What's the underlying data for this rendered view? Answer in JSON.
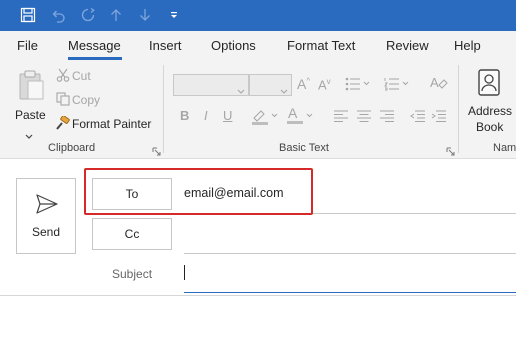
{
  "quick_access": {
    "icons": [
      "save-icon",
      "undo-icon",
      "redo-icon",
      "arrow-up-icon",
      "arrow-down-icon",
      "customize-icon"
    ]
  },
  "tabs": [
    {
      "label": "File",
      "active": false
    },
    {
      "label": "Message",
      "active": true
    },
    {
      "label": "Insert",
      "active": false
    },
    {
      "label": "Options",
      "active": false
    },
    {
      "label": "Format Text",
      "active": false
    },
    {
      "label": "Review",
      "active": false
    },
    {
      "label": "Help",
      "active": false
    }
  ],
  "ribbon": {
    "clipboard": {
      "paste_label": "Paste",
      "cut_label": "Cut",
      "copy_label": "Copy",
      "format_painter_label": "Format Painter",
      "group_label": "Clipboard"
    },
    "basic_text": {
      "group_label": "Basic Text",
      "bold": "B",
      "italic": "I",
      "underline": "U"
    },
    "names": {
      "address_book_line1": "Address",
      "address_book_line2": "Book",
      "group_label": "Nam"
    }
  },
  "compose": {
    "send_label": "Send",
    "to_label": "To",
    "to_value": "email@email.com",
    "cc_label": "Cc",
    "subject_label": "Subject"
  },
  "colors": {
    "accent": "#2b6bbf",
    "ribbon_bg": "#f3f3f3",
    "highlight": "#d62a2a"
  }
}
